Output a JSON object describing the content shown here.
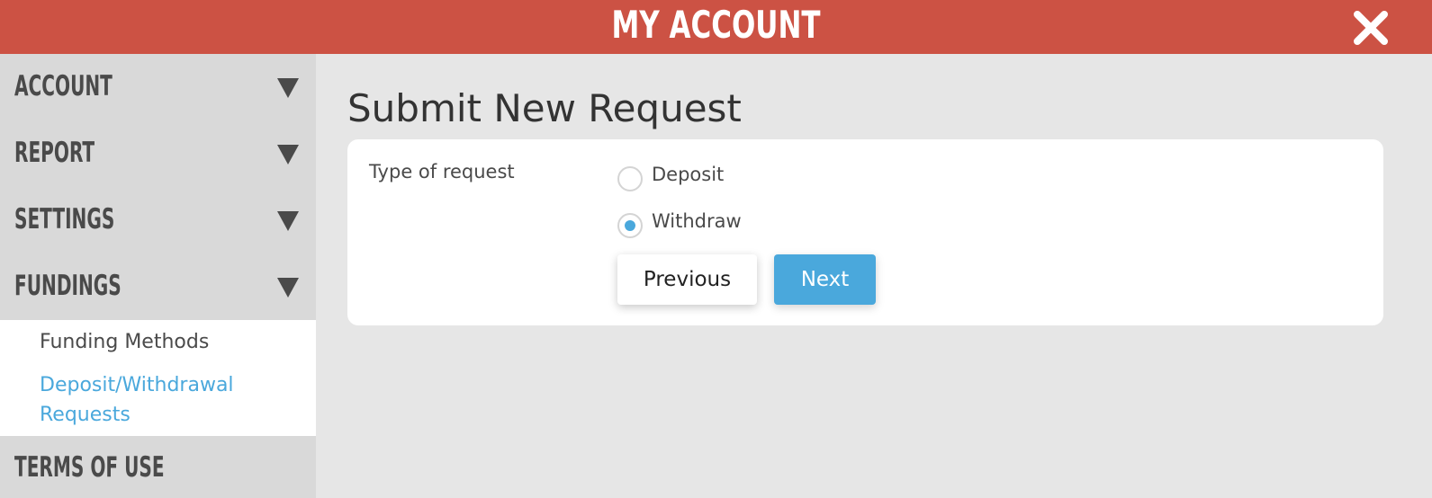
{
  "header": {
    "title": "MY ACCOUNT",
    "close_icon": "close-icon",
    "background": "#cc5244"
  },
  "sidebar": {
    "items": [
      {
        "label": "ACCOUNT",
        "icon": "chevron-down-icon"
      },
      {
        "label": "REPORT",
        "icon": "chevron-down-icon"
      },
      {
        "label": "SETTINGS",
        "icon": "chevron-down-icon"
      },
      {
        "label": "FUNDINGS",
        "icon": "chevron-down-icon",
        "expanded": true
      },
      {
        "label": "TERMS OF USE"
      }
    ],
    "submenu": {
      "funding_methods": "Funding Methods",
      "deposit_withdrawal_line1": "Deposit/Withdrawal",
      "deposit_withdrawal_line2": "Requests"
    }
  },
  "main": {
    "title": "Submit New Request",
    "form": {
      "type_label": "Type of request",
      "options": [
        {
          "label": "Deposit",
          "checked": false
        },
        {
          "label": "Withdraw",
          "checked": true
        }
      ],
      "previous_label": "Previous",
      "next_label": "Next"
    }
  },
  "colors": {
    "accent": "#4aa8dc",
    "header": "#cc5244",
    "sidebar": "#d9d9d9",
    "background": "#e6e6e6"
  }
}
